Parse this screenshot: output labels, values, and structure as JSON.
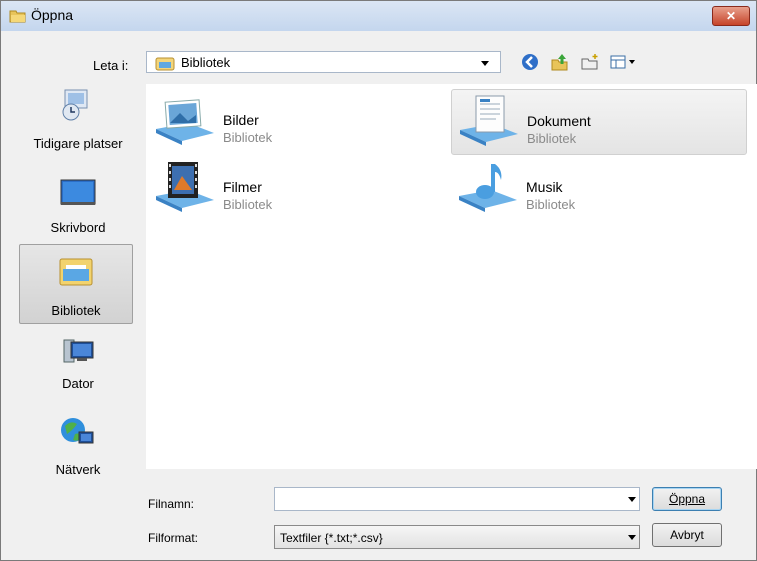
{
  "window": {
    "title": "Öppna",
    "close_label": "✕"
  },
  "lookin": {
    "label": "Leta i:",
    "value": "Bibliotek"
  },
  "toolbar": {
    "back_label": "Tillbaka",
    "up_label": "Upp",
    "newfolder_label": "Ny mapp",
    "views_label": "Visa"
  },
  "places": [
    {
      "label": "Tidigare platser"
    },
    {
      "label": "Skrivbord"
    },
    {
      "label": "Bibliotek"
    },
    {
      "label": "Dator"
    },
    {
      "label": "Nätverk"
    }
  ],
  "items": [
    {
      "name": "Bilder",
      "type": "Bibliotek"
    },
    {
      "name": "Dokument",
      "type": "Bibliotek"
    },
    {
      "name": "Filmer",
      "type": "Bibliotek"
    },
    {
      "name": "Musik",
      "type": "Bibliotek"
    }
  ],
  "filename": {
    "label": "Filnamn:",
    "value": "",
    "placeholder": ""
  },
  "filetype": {
    "label": "Filformat:",
    "value": "Textfiler {*.txt;*.csv}"
  },
  "buttons": {
    "open": "Öppna",
    "cancel": "Avbryt"
  },
  "colors": {
    "titlebar": "#c4d6ee",
    "close": "#c6442a",
    "selection": "#d2d2d2",
    "secondary_text": "#8a8a8a"
  }
}
